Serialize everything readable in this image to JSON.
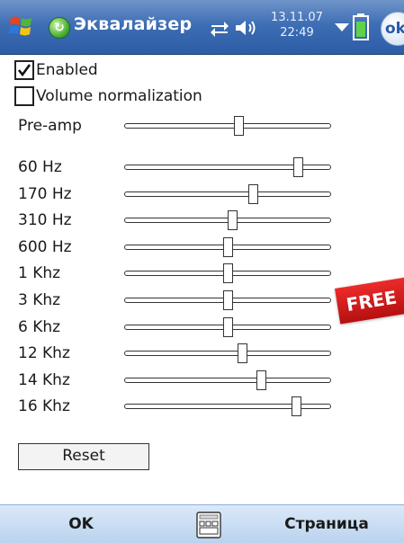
{
  "statusbar": {
    "app_title": "Эквалайзер",
    "date": "13.11.07",
    "time": "22:49",
    "ok_label": "ok",
    "icons": [
      "windows-logo-icon",
      "equalizer-app-icon",
      "connectivity-icon",
      "volume-icon",
      "tray-arrow-icon",
      "battery-icon"
    ]
  },
  "options": {
    "enabled_label": "Enabled",
    "enabled_checked": true,
    "volume_norm_label": "Volume normalization",
    "volume_norm_checked": false
  },
  "preamp": {
    "label": "Pre-amp",
    "level": 0.55
  },
  "bands": [
    {
      "label": "60 Hz",
      "level": 0.84
    },
    {
      "label": "170 Hz",
      "level": 0.62
    },
    {
      "label": "310 Hz",
      "level": 0.52
    },
    {
      "label": "600 Hz",
      "level": 0.5
    },
    {
      "label": "1 Khz",
      "level": 0.5
    },
    {
      "label": "3 Khz",
      "level": 0.5
    },
    {
      "label": "6 Khz",
      "level": 0.5
    },
    {
      "label": "12 Khz",
      "level": 0.57
    },
    {
      "label": "14 Khz",
      "level": 0.66
    },
    {
      "label": "16 Khz",
      "level": 0.83
    }
  ],
  "reset_label": "Reset",
  "badge_text": "FREE",
  "softkeys": {
    "left": "OK",
    "right": "Страница",
    "keyboard_icon": "keyboard-icon"
  },
  "colors": {
    "titlebar": "#3e6eb4",
    "bottombar": "#c8dcf2",
    "badge": "#d41b1b"
  }
}
